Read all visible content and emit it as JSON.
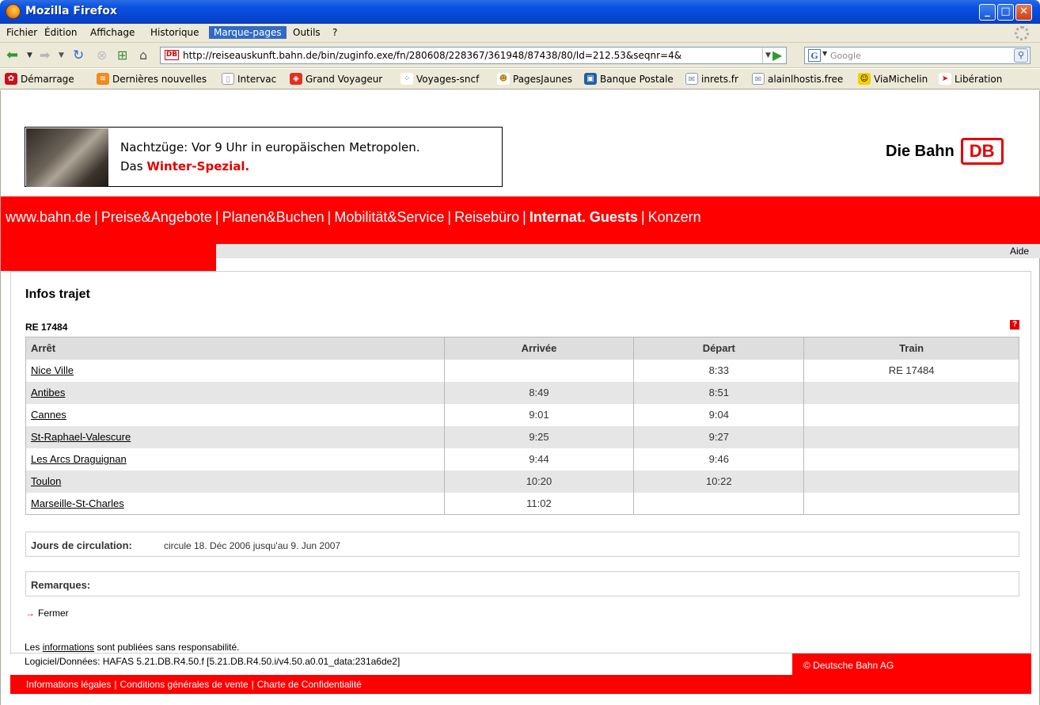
{
  "window": {
    "title": "Mozilla Firefox"
  },
  "menu": [
    "Fichier",
    "Édition",
    "Affichage",
    "Historique",
    "Marque-pages",
    "Outils",
    "?"
  ],
  "active_menu": "Marque-pages",
  "url": "http://reiseauskunft.bahn.de/bin/zuginfo.exe/fn/280608/228367/361948/87438/80/ld=212.53&seqnr=4&",
  "search_placeholder": "Google",
  "bookmarks": [
    "Démarrage",
    "Dernières nouvelles",
    "Intervac",
    "Grand Voyageur",
    "Voyages-sncf",
    "PagesJaunes",
    "Banque Postale",
    "inrets.fr",
    "alainlhostis.free",
    "ViaMichelin",
    "Libération"
  ],
  "banner": {
    "line1": "Nachtzüge: Vor 9 Uhr in europäischen Metropolen.",
    "line2_prefix": "Das ",
    "line2_highlight": "Winter-Spezial."
  },
  "logo": {
    "text": "Die Bahn",
    "badge": "DB"
  },
  "nav": [
    "www.bahn.de",
    "Preise&Angebote",
    "Planen&Buchen",
    "Mobilität&Service",
    "Reisebüro",
    "Internat. Guests",
    "Konzern"
  ],
  "aide": "Aide",
  "page": {
    "title": "Infos trajet",
    "train_number": "RE 17484",
    "help_icon": "?",
    "columns": [
      "Arrêt",
      "Arrivée",
      "Départ",
      "Train"
    ],
    "rows": [
      {
        "stop": "Nice Ville",
        "arr": "",
        "dep": "8:33",
        "train": "RE 17484"
      },
      {
        "stop": "Antibes",
        "arr": "8:49",
        "dep": "8:51",
        "train": ""
      },
      {
        "stop": "Cannes",
        "arr": "9:01",
        "dep": "9:04",
        "train": ""
      },
      {
        "stop": "St-Raphael-Valescure",
        "arr": "9:25",
        "dep": "9:27",
        "train": ""
      },
      {
        "stop": "Les Arcs Draguignan",
        "arr": "9:44",
        "dep": "9:46",
        "train": ""
      },
      {
        "stop": "Toulon",
        "arr": "10:20",
        "dep": "10:22",
        "train": ""
      },
      {
        "stop": "Marseille-St-Charles",
        "arr": "11:02",
        "dep": "",
        "train": ""
      }
    ],
    "jours_label": "Jours de circulation:",
    "jours_value": "circule 18. Déc 2006 jusqu'au 9. Jun 2007",
    "remarques_label": "Remarques:",
    "fermer": "Fermer"
  },
  "footer": {
    "disclaimer_prefix": "Les ",
    "disclaimer_link": "informations",
    "disclaimer_suffix": " sont publiées sans responsabilité.",
    "logiciel": "Logiciel/Données: HAFAS 5.21.DB.R4.50.f [5.21.DB.R4.50.i/v4.50.a0.01_data:231a6de2]",
    "copyright": "© Deutsche Bahn AG",
    "links": [
      "Informations légales",
      "Conditions générales de vente",
      "Charte de Confidentialité"
    ]
  }
}
